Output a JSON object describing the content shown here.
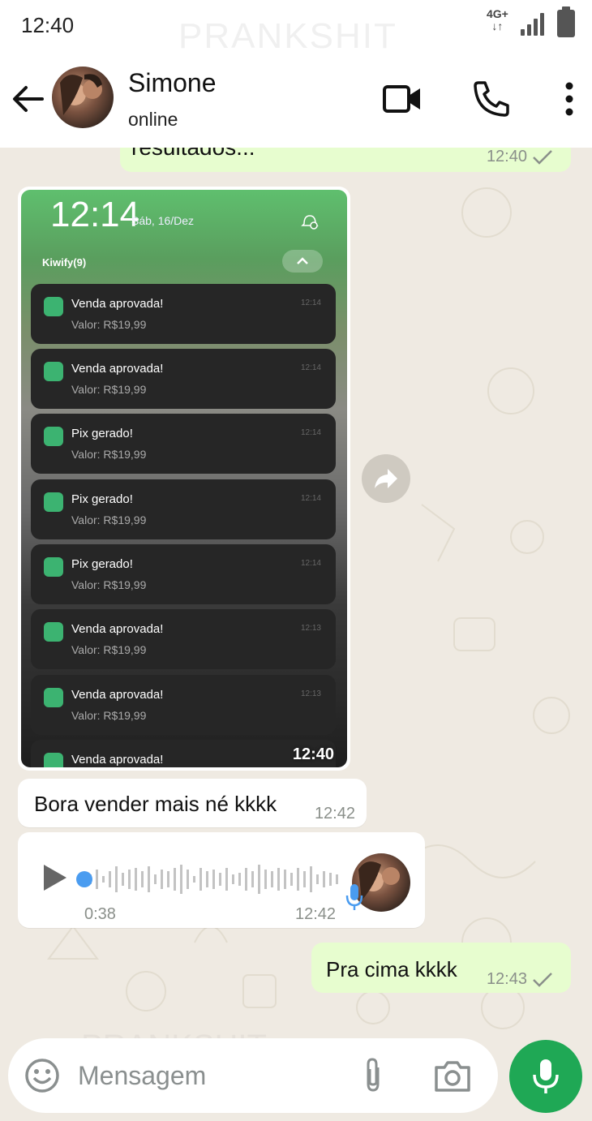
{
  "status_bar": {
    "time": "12:40",
    "network": "4G+",
    "watermark": "PRANKSHIT"
  },
  "header": {
    "contact_name": "Simone",
    "contact_status": "online"
  },
  "messages": {
    "top_out": {
      "text": "resultados...",
      "time": "12:40"
    },
    "image": {
      "time": "12:40",
      "screenshot": {
        "clock": "12:14",
        "date": "Sáb, 16/Dez",
        "group_label": "Kiwify(9)",
        "notifications": [
          {
            "title": "Venda aprovada!",
            "body": "Valor: R$19,99",
            "time": "12:14"
          },
          {
            "title": "Venda aprovada!",
            "body": "Valor: R$19,99",
            "time": "12:14"
          },
          {
            "title": "Pix gerado!",
            "body": "Valor: R$19,99",
            "time": "12:14"
          },
          {
            "title": "Pix gerado!",
            "body": "Valor: R$19,99",
            "time": "12:14"
          },
          {
            "title": "Pix gerado!",
            "body": "Valor: R$19,99",
            "time": "12:14"
          },
          {
            "title": "Venda aprovada!",
            "body": "Valor: R$19,99",
            "time": "12:13"
          },
          {
            "title": "Venda aprovada!",
            "body": "Valor: R$19,99",
            "time": "12:13"
          },
          {
            "title": "Venda aprovada!",
            "body": "",
            "time": ""
          }
        ]
      }
    },
    "text_in": {
      "text": "Bora vender mais né kkkk",
      "time": "12:42"
    },
    "audio_in": {
      "duration": "0:38",
      "time": "12:42",
      "progress": 0.0
    },
    "text_out": {
      "text": "Pra cima kkkk",
      "time": "12:43"
    }
  },
  "composer": {
    "placeholder": "Mensagem",
    "watermark": "PRANKSHIT"
  },
  "colors": {
    "outgoing_bubble": "#e7fdcf",
    "incoming_bubble": "#ffffff",
    "accent_green": "#1fa855",
    "chat_background": "#efeae2",
    "audio_dot": "#4a9cf0"
  }
}
